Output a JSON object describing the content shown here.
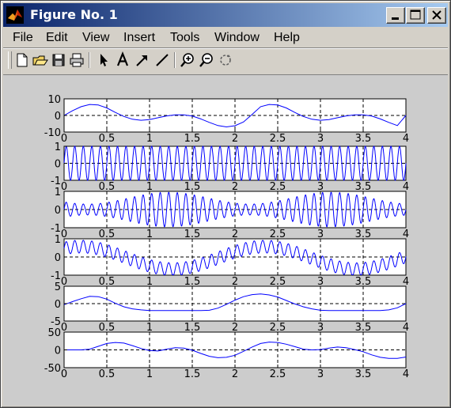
{
  "window": {
    "title": "Figure No. 1"
  },
  "menu": {
    "items": [
      "File",
      "Edit",
      "View",
      "Insert",
      "Tools",
      "Window",
      "Help"
    ]
  },
  "toolbar": {
    "tools": [
      "new-figure-icon",
      "open-file-icon",
      "save-icon",
      "print-icon",
      "select-arrow-icon",
      "insert-text-icon",
      "insert-arrow-icon",
      "insert-line-icon",
      "zoom-in-icon",
      "zoom-out-icon",
      "rotate-3d-icon"
    ]
  },
  "chart_data": [
    {
      "type": "line",
      "xlim": [
        0,
        4
      ],
      "ylim": [
        -10,
        10
      ],
      "xticks": [
        "0",
        "0.5",
        "1",
        "1.5",
        "2",
        "2.5",
        "3",
        "3.5",
        "4"
      ],
      "yticks": [
        "10",
        "0",
        "-10"
      ],
      "grid": "x dashed, y=0 dashed",
      "series": [
        {
          "color": "#0000ff",
          "x": [
            0,
            0.1,
            0.2,
            0.3,
            0.4,
            0.5,
            0.6,
            0.7,
            0.8,
            0.9,
            1.0,
            1.1,
            1.2,
            1.3,
            1.4,
            1.5,
            1.6,
            1.7,
            1.8,
            1.9,
            2.0,
            2.1,
            2.2,
            2.3,
            2.4,
            2.5,
            2.6,
            2.7,
            2.8,
            2.9,
            3.0,
            3.1,
            3.2,
            3.3,
            3.4,
            3.5,
            3.6,
            3.7,
            3.8,
            3.9,
            4.0
          ],
          "y": [
            0,
            2.9,
            5.3,
            6.6,
            6.3,
            4.5,
            1.8,
            -0.6,
            -2.3,
            -2.9,
            -2.5,
            -1.4,
            -0.3,
            0.4,
            0.4,
            -0.4,
            -2.1,
            -4.2,
            -6.1,
            -6.9,
            -6.2,
            -3.9,
            0.6,
            5.3,
            6.6,
            6.3,
            4.5,
            1.8,
            -0.6,
            -2.3,
            -2.9,
            -2.5,
            -1.4,
            -0.3,
            0.4,
            0.4,
            -0.4,
            -2.1,
            -4.2,
            -6.1,
            0
          ]
        }
      ]
    },
    {
      "type": "line",
      "xlim": [
        0,
        4
      ],
      "ylim": [
        -1,
        1
      ],
      "xticks": [
        "0",
        "0.5",
        "1",
        "1.5",
        "2",
        "2.5",
        "3",
        "3.5",
        "4"
      ],
      "yticks": [
        "1",
        "0",
        "-1"
      ],
      "grid": "x dashed, y=0 dashed",
      "series": [
        {
          "color": "#0000ff",
          "waveform": "sinusoid",
          "amplitude": 1.0,
          "cycles": 40
        }
      ]
    },
    {
      "type": "line",
      "xlim": [
        0,
        4
      ],
      "ylim": [
        -1,
        1
      ],
      "xticks": [
        "0",
        "0.5",
        "1",
        "1.5",
        "2",
        "2.5",
        "3",
        "3.5",
        "4"
      ],
      "yticks": [
        "1",
        "0",
        "-1"
      ],
      "grid": "x dashed, y=0 dashed",
      "series": [
        {
          "color": "#0000ff",
          "waveform": "modulated sinusoid",
          "amplitude_min": 0.3,
          "amplitude_max": 0.95,
          "cycles": 40
        }
      ]
    },
    {
      "type": "line",
      "xlim": [
        0,
        4
      ],
      "ylim": [
        -1,
        1
      ],
      "xticks": [
        "0",
        "0.5",
        "1",
        "1.5",
        "2",
        "2.5",
        "3",
        "3.5",
        "4"
      ],
      "yticks": [
        "1",
        "0",
        "-1"
      ],
      "grid": "x dashed, y=0 dashed",
      "series": [
        {
          "color": "#0000ff",
          "waveform": "carrier plus slow envelope",
          "amplitude": 0.35,
          "cycles": 40
        }
      ]
    },
    {
      "type": "line",
      "xlim": [
        0,
        4
      ],
      "ylim": [
        -5,
        5
      ],
      "xticks": [
        "0",
        "0.5",
        "1",
        "1.5",
        "2",
        "2.5",
        "3",
        "3.5",
        "4"
      ],
      "yticks": [
        "5",
        "0",
        "-5"
      ],
      "grid": "x dashed, y=0 dashed",
      "series": [
        {
          "color": "#0000ff",
          "x": [
            0,
            0.1,
            0.2,
            0.3,
            0.4,
            0.5,
            0.6,
            0.7,
            0.8,
            0.9,
            1.0,
            1.1,
            1.2,
            1.3,
            1.4,
            1.5,
            1.6,
            1.7,
            1.8,
            1.9,
            2.0,
            2.1,
            2.2,
            2.3,
            2.4,
            2.5,
            2.6,
            2.7,
            2.8,
            2.9,
            3.0,
            3.1,
            3.2,
            3.3,
            3.4,
            3.5,
            3.6,
            3.7,
            3.8,
            3.9,
            4.0
          ],
          "y": [
            -0.3,
            0.6,
            1.4,
            2.1,
            2.0,
            1.3,
            0.1,
            -0.9,
            -1.5,
            -1.8,
            -2.0,
            -2.0,
            -2.0,
            -2.0,
            -2.0,
            -2.0,
            -2.0,
            -1.9,
            -1.3,
            -0.2,
            1.0,
            2.0,
            2.6,
            2.8,
            2.5,
            1.9,
            0.9,
            -0.1,
            -0.9,
            -1.5,
            -1.9,
            -2.0,
            -2.0,
            -2.0,
            -2.0,
            -2.0,
            -2.0,
            -2.0,
            -1.8,
            -1.2,
            0
          ]
        }
      ]
    },
    {
      "type": "line",
      "xlim": [
        0,
        4
      ],
      "ylim": [
        -50,
        50
      ],
      "xticks": [
        "0",
        "0.5",
        "1",
        "1.5",
        "2",
        "2.5",
        "3",
        "3.5",
        "4"
      ],
      "yticks": [
        "50",
        "0",
        "-50"
      ],
      "grid": "x dashed, y=0 dashed",
      "series": [
        {
          "color": "#0000ff",
          "x": [
            0,
            0.1,
            0.2,
            0.3,
            0.4,
            0.5,
            0.6,
            0.7,
            0.8,
            0.9,
            1.0,
            1.1,
            1.2,
            1.3,
            1.4,
            1.5,
            1.6,
            1.7,
            1.8,
            1.9,
            2.0,
            2.1,
            2.2,
            2.3,
            2.4,
            2.5,
            2.6,
            2.7,
            2.8,
            2.9,
            3.0,
            3.1,
            3.2,
            3.3,
            3.4,
            3.5,
            3.6,
            3.7,
            3.8,
            3.9,
            4.0
          ],
          "y": [
            0,
            0,
            0,
            2,
            10,
            18,
            21,
            19,
            12,
            4,
            -2,
            -3,
            2,
            6,
            5,
            -1,
            -10,
            -18,
            -22,
            -21,
            -15,
            -4,
            8,
            18,
            22,
            21,
            16,
            9,
            2,
            0,
            1,
            5,
            8,
            6,
            1,
            -5,
            -14,
            -21,
            -24,
            -24,
            -20
          ]
        }
      ]
    }
  ]
}
